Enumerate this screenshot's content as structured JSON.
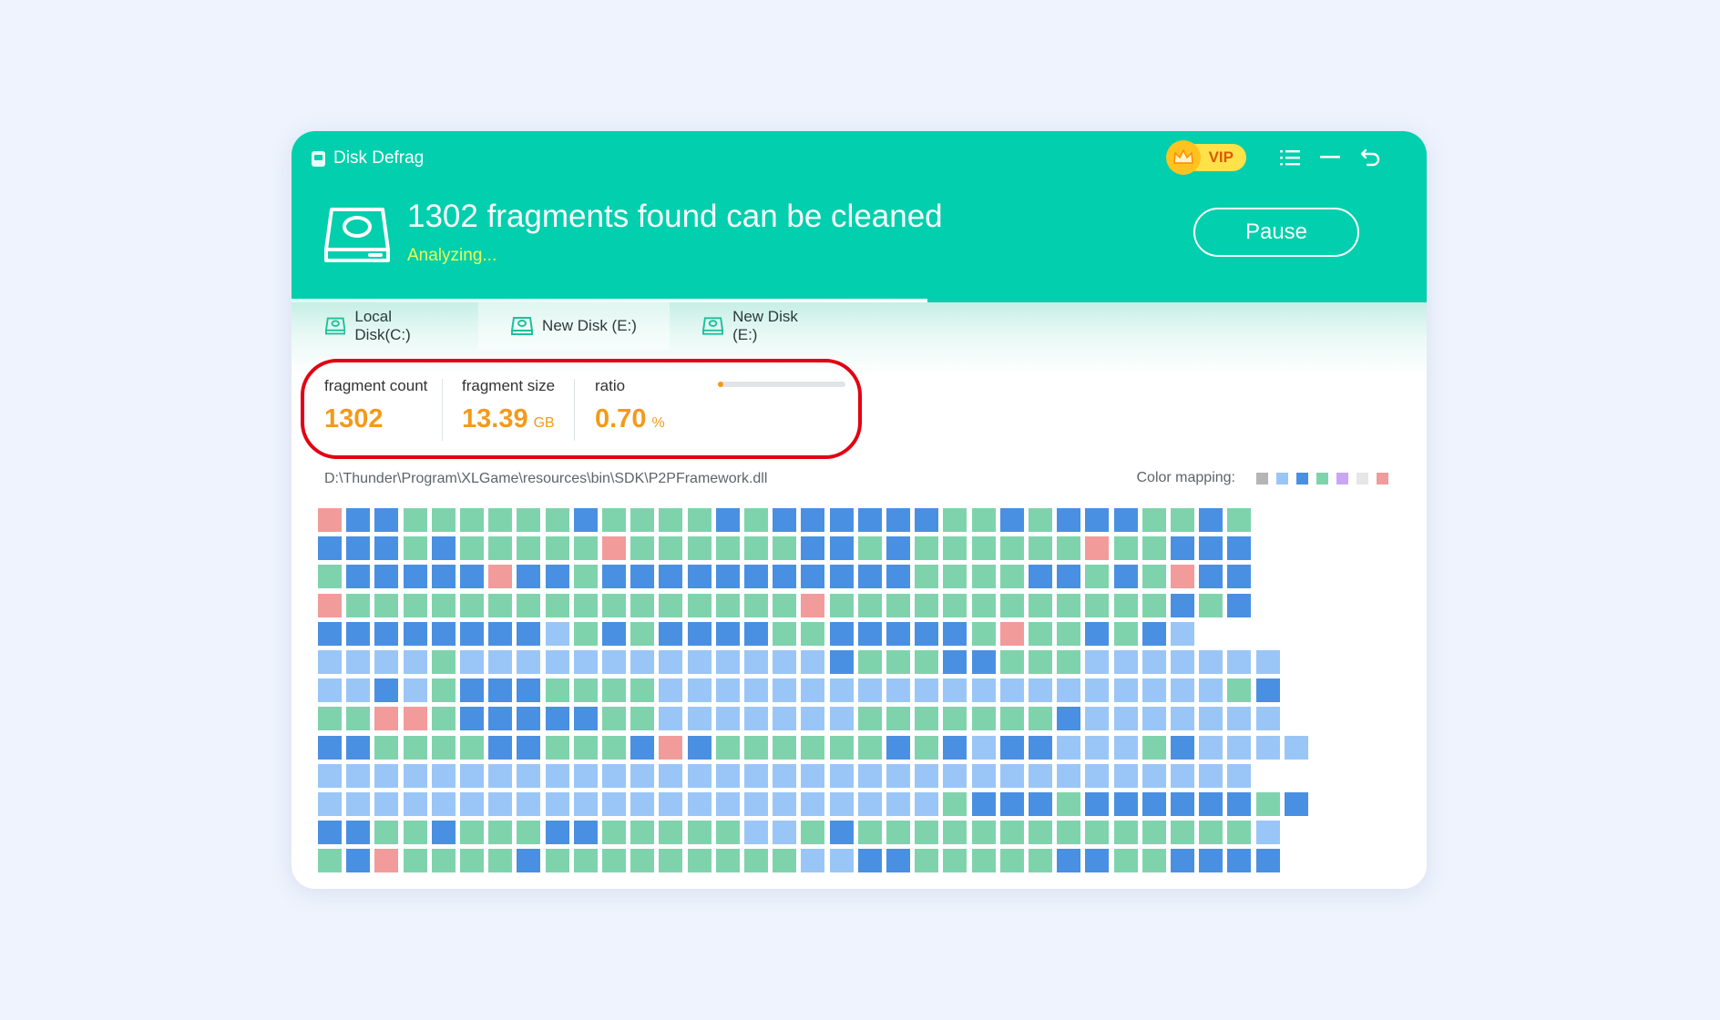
{
  "window": {
    "title": "Disk Defrag"
  },
  "vip": {
    "label": "VIP"
  },
  "header": {
    "headline": "1302 fragments found can be cleaned",
    "status": "Analyzing...",
    "pause_label": "Pause",
    "progress": 0.56
  },
  "tabs": [
    {
      "label": "Local Disk(C:)"
    },
    {
      "label": "New Disk (E:)"
    },
    {
      "label": "New Disk (E:)"
    }
  ],
  "stats": {
    "fragment_count": {
      "label": "fragment count",
      "value": "1302"
    },
    "fragment_size": {
      "label": "fragment size",
      "value": "13.39",
      "unit": "GB"
    },
    "ratio": {
      "label": "ratio",
      "value": "0.70",
      "unit": "%",
      "level": 0.007
    }
  },
  "file_path": "D:\\Thunder\\Program\\XLGame\\resources\\bin\\SDK\\P2PFramework.dll",
  "color_mapping": {
    "label": "Color mapping:",
    "colors": [
      "#b5b5b5",
      "#9ac6f7",
      "#4a90e2",
      "#7ed3ad",
      "#c9a6f4",
      "#e6e6e6",
      "#f29b9b"
    ]
  },
  "block_colors": {
    "R": "#f29b9b",
    "D": "#4a90e2",
    "G": "#7ed3ad",
    "L": "#9ac6f7"
  },
  "block_map": [
    "RDDGGGGGGDGGGGDGDDDDDDGGDGDDDGGDG",
    "DDDGDGGGGGRGGGGGGDDGDGGGGGGRGGDDD",
    "GDDDDDRDDGDDDDDDDDDDDGGGGDDGDGRDD",
    "RGGGGGGGGGGGGGGGGRGGGGGGGGGGGGDGD",
    "DDDDDDDDLGDGDDDDGGDDDDDGRGGDGDL",
    "LLLLGLLLLLLLLLLLLLDGGGDDGGGLLLLLLL",
    "LLDLGDDDGGGGLLLLLLLLLLLLLLLLLLLLGD",
    "GGRRGDDDDDGGLLLLLLLGGGGGGGDLLLLLLL",
    "DDGGGGDDGGGDRDGGGGGGDGDLDDLLLGDLLLL",
    "LLLLLLLLLLLLLLLLLLLLLLLLLLLLLLLLL",
    "LLLLLLLLLLLLLLLLLLLLLLGDDDGDDDDDDGD",
    "DDGGDGGGDDGGGGGLLGDGGGGGGGGGGGGGGL",
    "GDRGGGGDGGGGGGGGGLLDDGGGGGDDGGDDDD"
  ]
}
